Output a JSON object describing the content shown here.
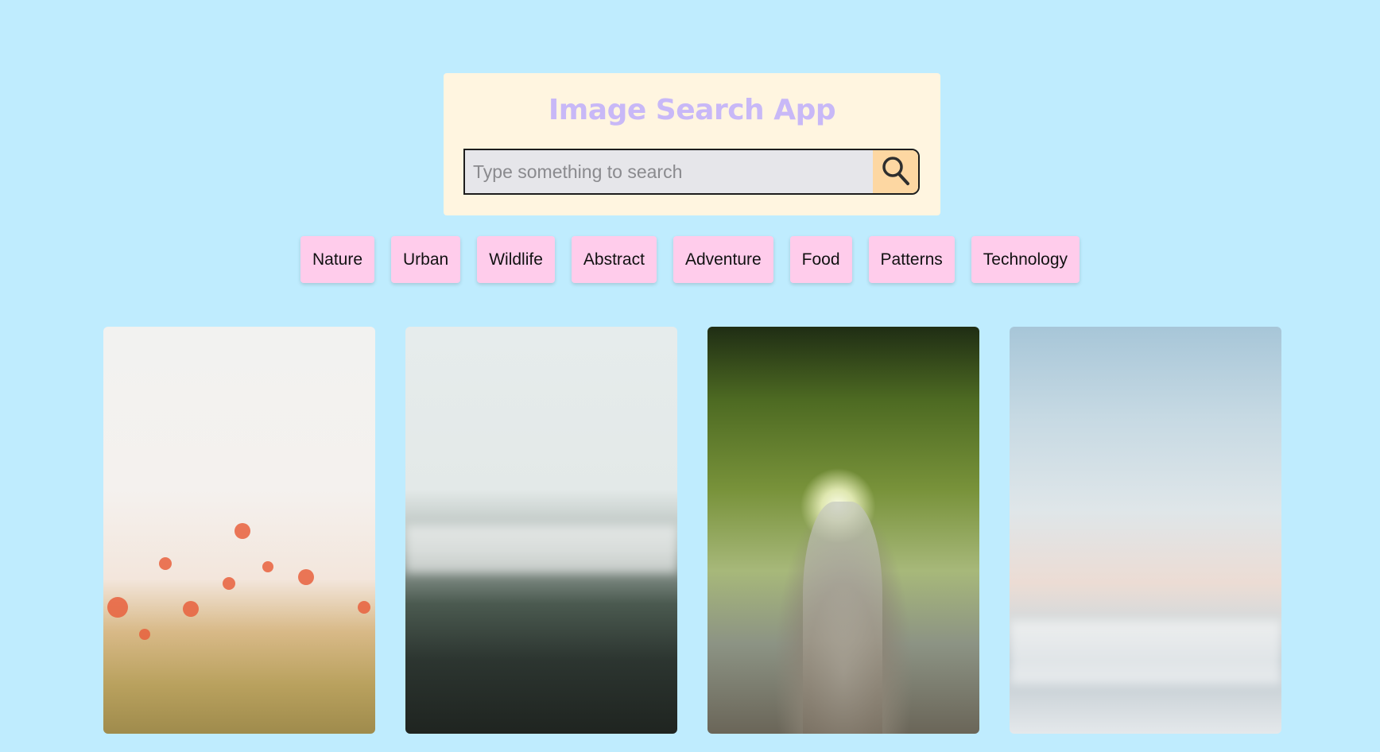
{
  "header": {
    "title": "Image Search App"
  },
  "search": {
    "placeholder": "Type something to search",
    "value": "",
    "button_icon": "search-icon"
  },
  "categories": [
    {
      "label": "Nature"
    },
    {
      "label": "Urban"
    },
    {
      "label": "Wildlife"
    },
    {
      "label": "Abstract"
    },
    {
      "label": "Adventure"
    },
    {
      "label": "Food"
    },
    {
      "label": "Patterns"
    },
    {
      "label": "Technology"
    }
  ],
  "gallery": {
    "images": [
      {
        "subject": "red poppies in field"
      },
      {
        "subject": "misty pine forest"
      },
      {
        "subject": "large tree with sunlight"
      },
      {
        "subject": "clouds at dawn"
      }
    ]
  },
  "colors": {
    "page_background": "#bfecfe",
    "card_background": "#fff5e0",
    "title": "#c8b8f7",
    "category_button": "#ffcceb",
    "search_button": "#fdd7a2",
    "search_field": "#e6e6ea"
  }
}
